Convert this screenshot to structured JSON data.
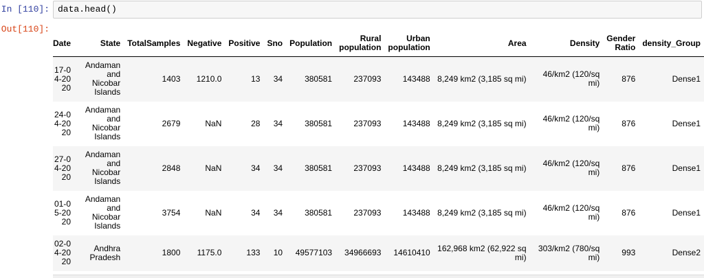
{
  "input_cell": {
    "prompt": "In [110]:",
    "code": "data.head()"
  },
  "output": {
    "prompt": "Out[110]:",
    "columns": [
      "Date",
      "State",
      "TotalSamples",
      "Negative",
      "Positive",
      "Sno",
      "Population",
      "Rural population",
      "Urban population",
      "Area",
      "Density",
      "Gender Ratio",
      "density_Group"
    ],
    "rows": [
      [
        "17-04-2020",
        "Andaman and Nicobar Islands",
        "1403",
        "1210.0",
        "13",
        "34",
        "380581",
        "237093",
        "143488",
        "8,249 km2 (3,185 sq mi)",
        "46/km2 (120/sq mi)",
        "876",
        "Dense1"
      ],
      [
        "24-04-2020",
        "Andaman and Nicobar Islands",
        "2679",
        "NaN",
        "28",
        "34",
        "380581",
        "237093",
        "143488",
        "8,249 km2 (3,185 sq mi)",
        "46/km2 (120/sq mi)",
        "876",
        "Dense1"
      ],
      [
        "27-04-2020",
        "Andaman and Nicobar Islands",
        "2848",
        "NaN",
        "34",
        "34",
        "380581",
        "237093",
        "143488",
        "8,249 km2 (3,185 sq mi)",
        "46/km2 (120/sq mi)",
        "876",
        "Dense1"
      ],
      [
        "01-05-2020",
        "Andaman and Nicobar Islands",
        "3754",
        "NaN",
        "34",
        "34",
        "380581",
        "237093",
        "143488",
        "8,249 km2 (3,185 sq mi)",
        "46/km2 (120/sq mi)",
        "876",
        "Dense1"
      ],
      [
        "02-04-2020",
        "Andhra Pradesh",
        "1800",
        "1175.0",
        "133",
        "10",
        "49577103",
        "34966693",
        "14610410",
        "162,968 km2 (62,922 sq mi)",
        "303/km2 (780/sq mi)",
        "993",
        "Dense2"
      ]
    ]
  }
}
